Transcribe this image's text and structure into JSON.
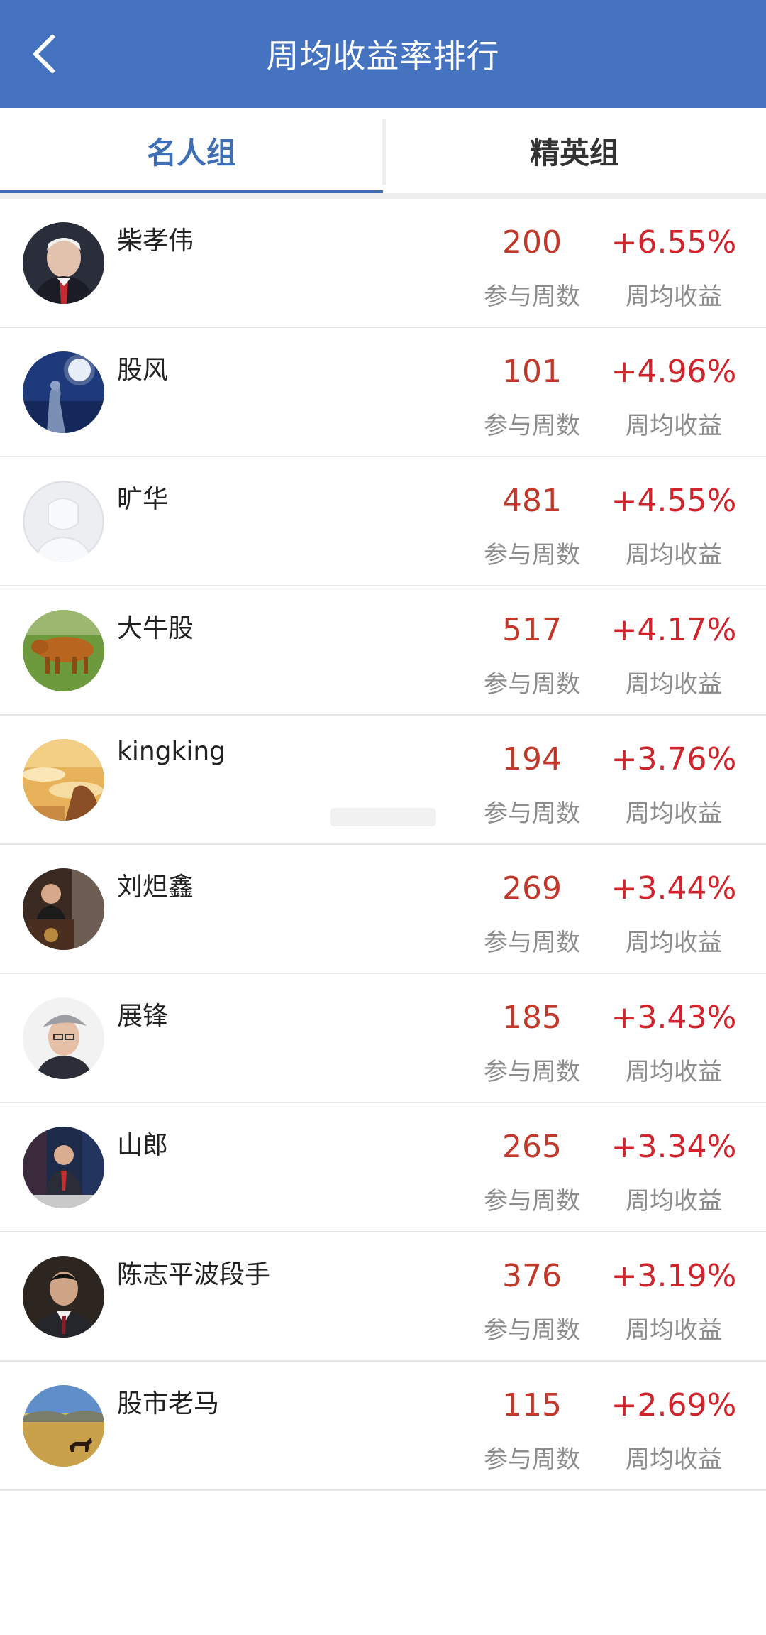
{
  "header": {
    "title": "周均收益率排行",
    "back_icon": "chevron-left-icon",
    "background": "#4673c0"
  },
  "tabs": [
    {
      "label": "名人组",
      "active": true
    },
    {
      "label": "精英组",
      "active": false
    }
  ],
  "columns": {
    "weeks_label": "参与周数",
    "gain_label": "周均收益"
  },
  "colors": {
    "accent": "#3f6eb5",
    "gain_red": "#d0232b",
    "weeks_red": "#c0392b"
  },
  "rows": [
    {
      "name": "柴孝伟",
      "weeks": "200",
      "gain": "+6.55%",
      "avatar": "portrait-red-tie"
    },
    {
      "name": "股风",
      "weeks": "101",
      "gain": "+4.96%",
      "avatar": "moon-night-figure"
    },
    {
      "name": "旷华",
      "weeks": "481",
      "gain": "+4.55%",
      "avatar": "default-avatar"
    },
    {
      "name": "大牛股",
      "weeks": "517",
      "gain": "+4.17%",
      "avatar": "bull-on-grass"
    },
    {
      "name": "kingking",
      "weeks": "194",
      "gain": "+3.76%",
      "avatar": "sunset-clouds"
    },
    {
      "name": "刘炟鑫",
      "weeks": "269",
      "gain": "+3.44%",
      "avatar": "speaker-podium"
    },
    {
      "name": "展锋",
      "weeks": "185",
      "gain": "+3.43%",
      "avatar": "man-with-cap"
    },
    {
      "name": "山郎",
      "weeks": "265",
      "gain": "+3.34%",
      "avatar": "tv-studio-man"
    },
    {
      "name": "陈志平波段手",
      "weeks": "376",
      "gain": "+3.19%",
      "avatar": "man-in-suit"
    },
    {
      "name": "股市老马",
      "weeks": "115",
      "gain": "+2.69%",
      "avatar": "horse-on-steppe"
    }
  ]
}
